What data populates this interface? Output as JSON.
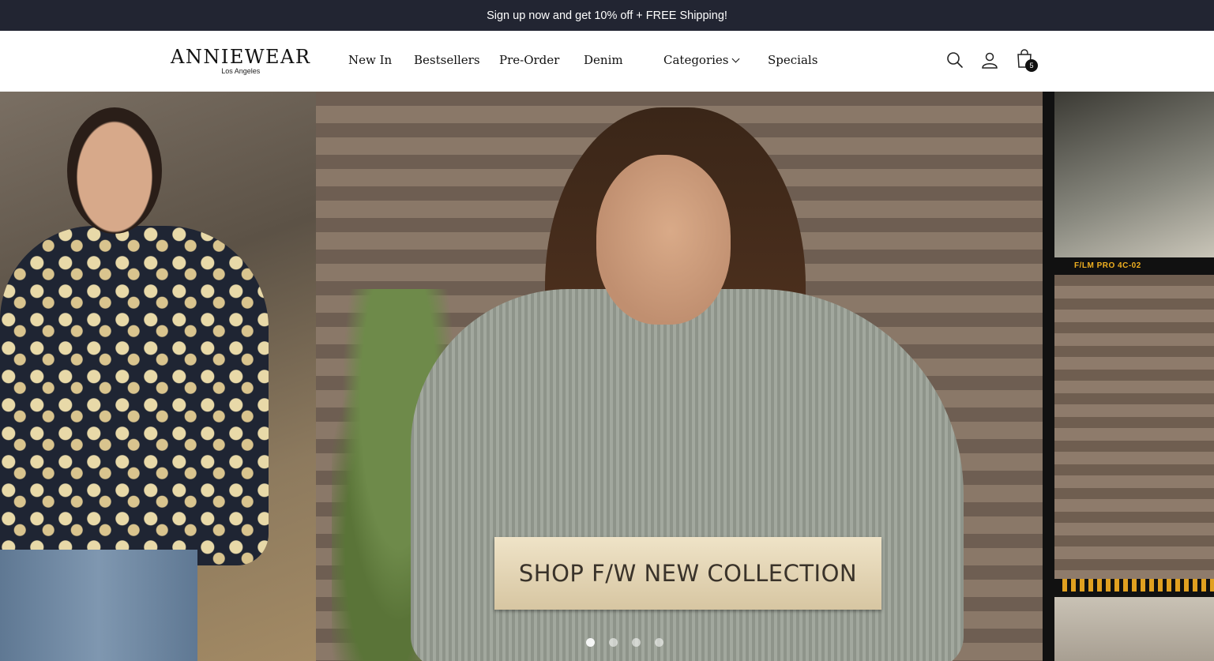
{
  "announcement": {
    "text": "Sign up now and get 10% off + FREE Shipping!"
  },
  "header": {
    "logo": {
      "name": "ANNIEWEAR",
      "subtitle": "Los Angeles"
    },
    "nav": [
      {
        "label": "New In"
      },
      {
        "label": "Bestsellers"
      },
      {
        "label": "Pre-Order"
      },
      {
        "label": "Denim"
      },
      {
        "label": "Categories",
        "has_dropdown": true
      },
      {
        "label": "Specials"
      }
    ],
    "icons": [
      "search-icon",
      "account-icon",
      "cart-icon"
    ],
    "cart_count": "5"
  },
  "hero": {
    "cta_label": "SHOP F/W NEW COLLECTION",
    "film_label": "F/LM PRO  4C-02",
    "slide_count": 4,
    "active_slide": 1
  },
  "colors": {
    "announcement_bg": "#222532",
    "text": "#111111",
    "banner_bg": "#e6d8b8"
  }
}
